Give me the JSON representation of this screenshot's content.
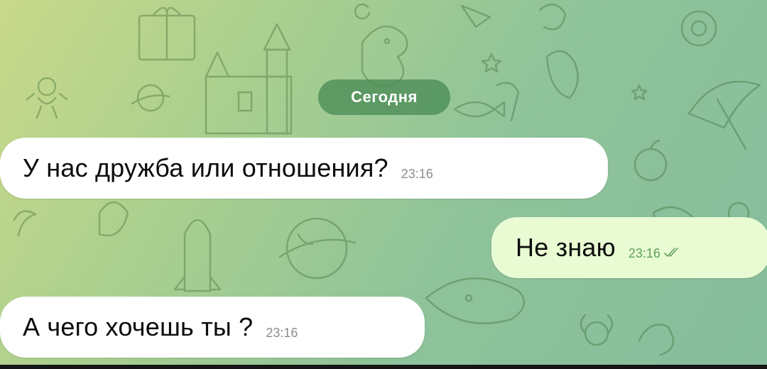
{
  "theme": {
    "incoming_bubble_color": "#ffffff",
    "outgoing_bubble_color": "#e9fbd3",
    "date_pill_color": "#4a8c56",
    "wallpaper_colors": [
      "#c9d98a",
      "#a9cf8f",
      "#8fc39a"
    ]
  },
  "date_separator": "Сегодня",
  "messages": [
    {
      "direction": "incoming",
      "text": "У нас дружба или отношения?",
      "time": "23:16"
    },
    {
      "direction": "outgoing",
      "text": "Не знаю",
      "time": "23:16",
      "status_icon": "double-check-icon"
    },
    {
      "direction": "incoming",
      "text": "А чего хочешь ты ?",
      "time": "23:16"
    }
  ]
}
